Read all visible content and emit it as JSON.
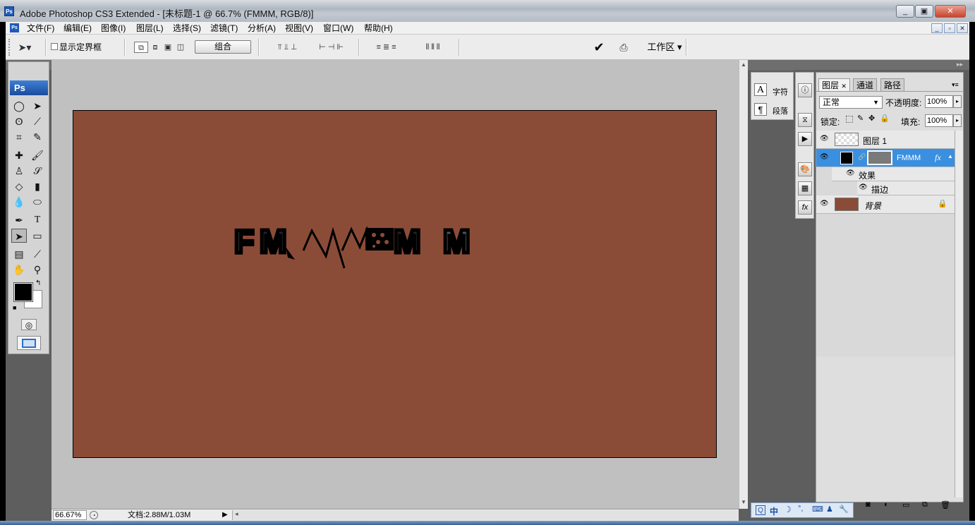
{
  "titlebar": {
    "title": "Adobe Photoshop CS3 Extended - [未标题-1 @ 66.7% (FMMM, RGB/8)]",
    "app_icon": "Ps",
    "min": "_",
    "max": "▣",
    "close": "✕"
  },
  "menubar": {
    "items": [
      "文件(F)",
      "编辑(E)",
      "图像(I)",
      "图层(L)",
      "选择(S)",
      "滤镜(T)",
      "分析(A)",
      "视图(V)",
      "窗口(W)",
      "帮助(H)"
    ]
  },
  "options": {
    "show_bounds": "显示定界框",
    "combine": "组合",
    "workspace": "工作区"
  },
  "tools": {
    "logo": "Ps"
  },
  "status": {
    "zoom": "66.67%",
    "doc": "文档:2.88M/1.03M"
  },
  "char_panel": {
    "char": "字符",
    "para": "段落"
  },
  "layers_panel": {
    "tabs": [
      "图层",
      "通道",
      "路径"
    ],
    "blend_mode": "正常",
    "opacity_label": "不透明度:",
    "opacity": "100%",
    "lock_label": "锁定:",
    "fill_label": "填充:",
    "fill": "100%",
    "layers": {
      "layer1": "图层 1",
      "fmmm": "FMMM",
      "effects": "效果",
      "stroke": "描边",
      "background": "背景"
    }
  },
  "tray": {
    "ime": "中"
  },
  "colors": {
    "canvas": "#8b4c37",
    "selected_layer": "#3a8fe0"
  }
}
